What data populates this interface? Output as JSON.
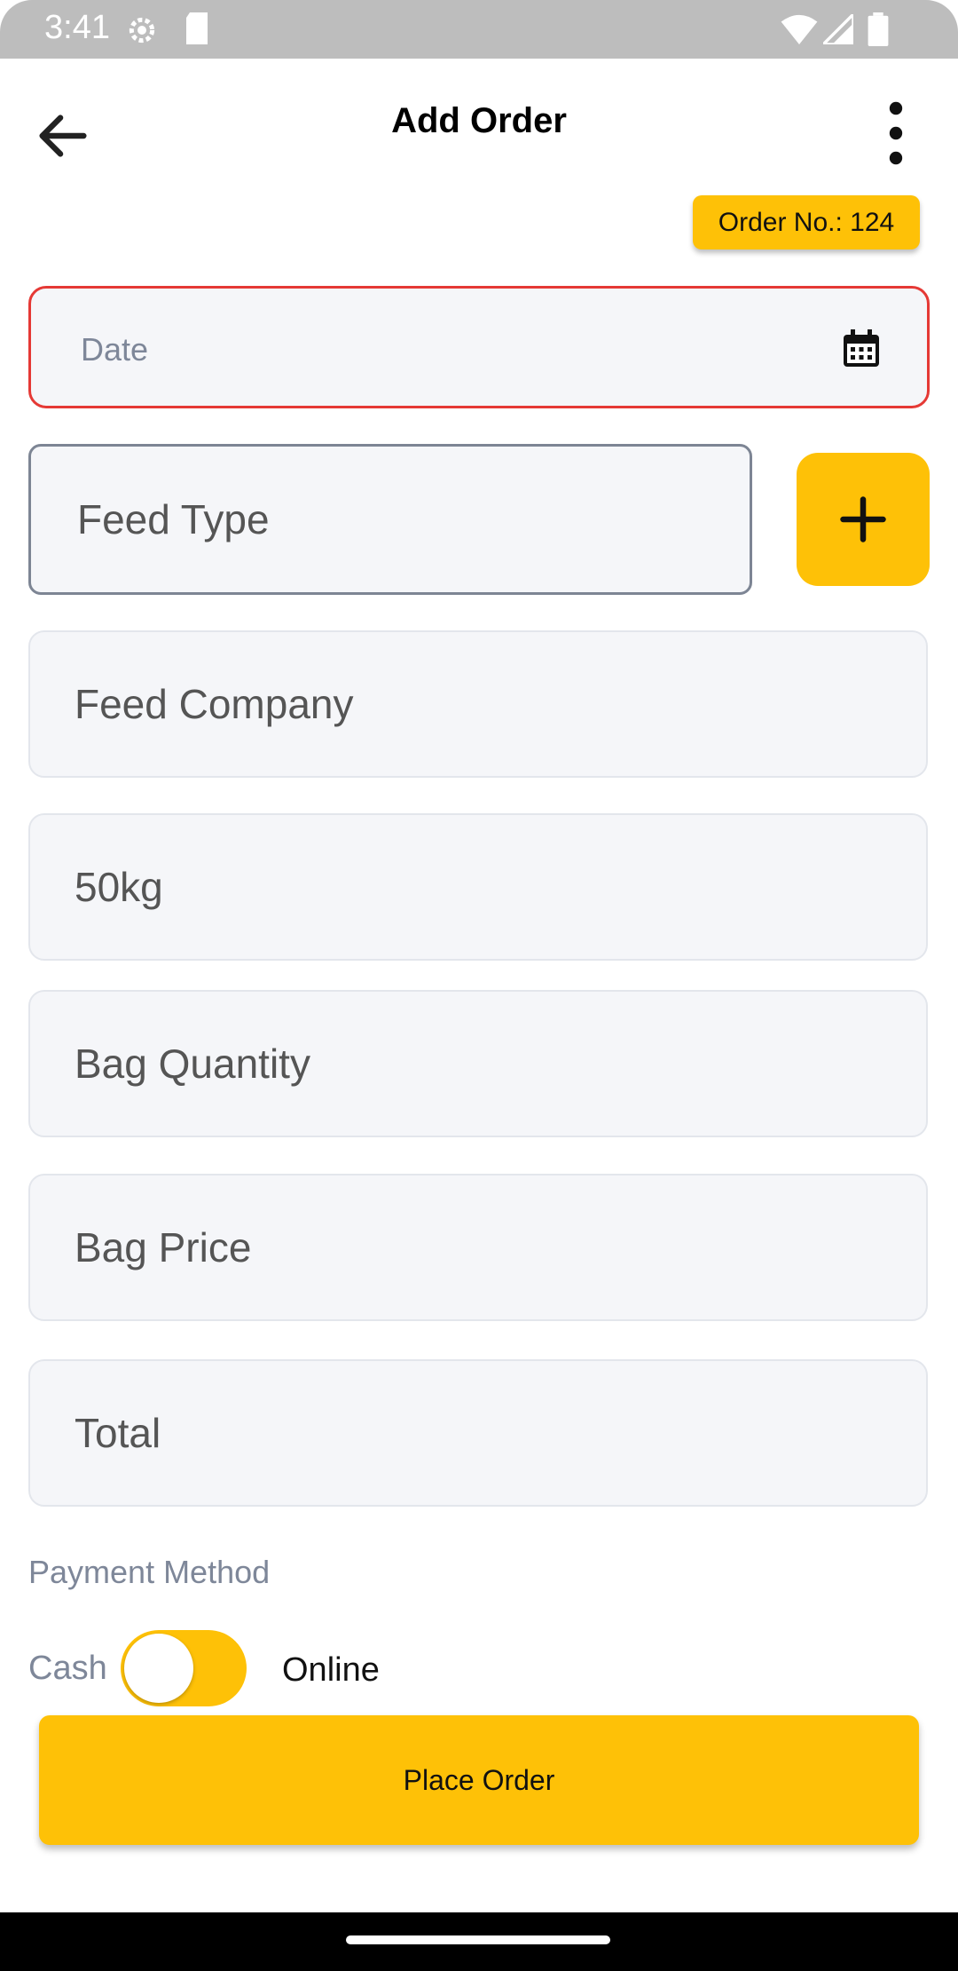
{
  "status_bar": {
    "time": "3:41",
    "icons": [
      "settings-icon",
      "sd-card-icon",
      "wifi-icon",
      "signal-icon",
      "battery-icon"
    ]
  },
  "app_bar": {
    "title": "Add Order",
    "back_icon": "arrow-left-icon",
    "menu_icon": "more-vertical-icon"
  },
  "order_number": "Order No.: 124",
  "form": {
    "date": {
      "placeholder": "Date",
      "icon": "calendar-icon"
    },
    "feed_type": {
      "placeholder": "Feed Type"
    },
    "add_button_icon": "plus-icon",
    "feed_company": {
      "placeholder": "Feed Company"
    },
    "bag_size": {
      "placeholder": "50kg"
    },
    "bag_quantity": {
      "placeholder": "Bag Quantity"
    },
    "bag_price": {
      "placeholder": "Bag Price"
    },
    "total": {
      "placeholder": "Total"
    }
  },
  "payment": {
    "label": "Payment Method",
    "option_left": "Cash",
    "option_right": "Online"
  },
  "place_order_label": "Place Order",
  "colors": {
    "accent": "#fec107",
    "error_border": "#e53935",
    "field_bg": "#f5f6f9",
    "muted_text": "#7e8799"
  }
}
